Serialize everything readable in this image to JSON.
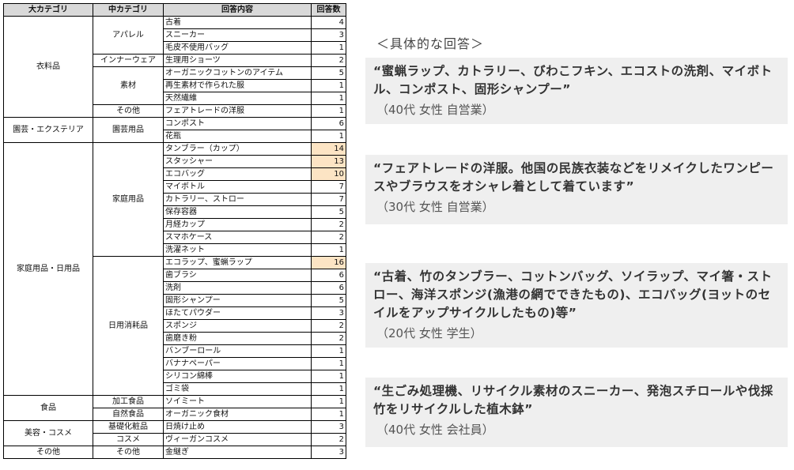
{
  "table": {
    "headers": [
      "大カテゴリ",
      "中カテゴリ",
      "回答内容",
      "回答数"
    ],
    "groups": [
      {
        "name": "衣料品",
        "subs": [
          {
            "name": "アパレル",
            "items": [
              {
                "label": "古着",
                "count": 4
              },
              {
                "label": "スニーカー",
                "count": 3
              },
              {
                "label": "毛皮不使用バッグ",
                "count": 1
              }
            ]
          },
          {
            "name": "インナーウェア",
            "items": [
              {
                "label": "生理用ショーツ",
                "count": 2
              }
            ]
          },
          {
            "name": "素材",
            "items": [
              {
                "label": "オーガニックコットンのアイテム",
                "count": 5
              },
              {
                "label": "再生素材で作られた服",
                "count": 1
              },
              {
                "label": "天然繊維",
                "count": 1
              }
            ]
          },
          {
            "name": "その他",
            "items": [
              {
                "label": "フェアトレードの洋服",
                "count": 1
              }
            ]
          }
        ]
      },
      {
        "name": "園芸・エクステリア",
        "subs": [
          {
            "name": "園芸用品",
            "items": [
              {
                "label": "コンポスト",
                "count": 6
              },
              {
                "label": "花瓶",
                "count": 1
              }
            ]
          }
        ]
      },
      {
        "name": "家庭用品・日用品",
        "subs": [
          {
            "name": "家庭用品",
            "items": [
              {
                "label": "タンブラー（カップ）",
                "count": 14,
                "highlight": true
              },
              {
                "label": "スタッシャー",
                "count": 13,
                "highlight": true
              },
              {
                "label": "エコバッグ",
                "count": 10,
                "highlight": true
              },
              {
                "label": "マイボトル",
                "count": 7
              },
              {
                "label": "カトラリー、ストロー",
                "count": 7
              },
              {
                "label": "保存容器",
                "count": 5
              },
              {
                "label": "月経カップ",
                "count": 2
              },
              {
                "label": "スマホケース",
                "count": 2
              },
              {
                "label": "洗濯ネット",
                "count": 1
              }
            ]
          },
          {
            "name": "日用消耗品",
            "items": [
              {
                "label": "エコラップ、蜜蝋ラップ",
                "count": 16,
                "highlight": true
              },
              {
                "label": "歯ブラシ",
                "count": 6
              },
              {
                "label": "洗剤",
                "count": 6
              },
              {
                "label": "固形シャンプー",
                "count": 5
              },
              {
                "label": "ほたてパウダー",
                "count": 3
              },
              {
                "label": "スポンジ",
                "count": 2
              },
              {
                "label": "歯磨き粉",
                "count": 2
              },
              {
                "label": "バンブーロール",
                "count": 1
              },
              {
                "label": "バナナペーパー",
                "count": 1
              },
              {
                "label": "シリコン綿棒",
                "count": 1
              },
              {
                "label": "ゴミ袋",
                "count": 1
              }
            ]
          }
        ]
      },
      {
        "name": "食品",
        "subs": [
          {
            "name": "加工食品",
            "items": [
              {
                "label": "ソイミート",
                "count": 1
              }
            ]
          },
          {
            "name": "自然食品",
            "items": [
              {
                "label": "オーガニック食材",
                "count": 1
              }
            ]
          }
        ]
      },
      {
        "name": "美容・コスメ",
        "subs": [
          {
            "name": "基礎化粧品",
            "items": [
              {
                "label": "日焼け止め",
                "count": 3
              }
            ]
          },
          {
            "name": "コスメ",
            "items": [
              {
                "label": "ヴィーガンコスメ",
                "count": 2
              }
            ]
          }
        ]
      },
      {
        "name": "その他",
        "subs": [
          {
            "name": "その他",
            "items": [
              {
                "label": "金継ぎ",
                "count": 3
              }
            ]
          }
        ]
      }
    ],
    "highlight_color": "#fce4c4"
  },
  "quotes": {
    "heading": "＜具体的な回答＞",
    "items": [
      {
        "text": "“蜜蝋ラップ、カトラリー、びわこフキン、エコストの洗剤、マイボトル、コンポスト、固形シャンプー”",
        "attr": "（40代 女性 自営業）"
      },
      {
        "text": "“フェアトレードの洋服。他国の民族衣装などをリメイクしたワンピースやブラウスをオシャレ着として着ています”",
        "attr": "（30代 女性 自営業）"
      },
      {
        "text": "“古着、竹のタンブラー、コットンバッグ、ソイラップ、マイ箸・ストロー、海洋スポンジ(漁港の網でできたもの)、エコバッグ(ヨットのセイルをアップサイクルしたもの)等”",
        "attr": "（20代 女性 学生）"
      },
      {
        "text": "“生ごみ処理機、リサイクル素材のスニーカー、発泡スチロールや伐採竹をリサイクルした植木鉢”",
        "attr": "（40代 女性 会社員）"
      }
    ]
  }
}
